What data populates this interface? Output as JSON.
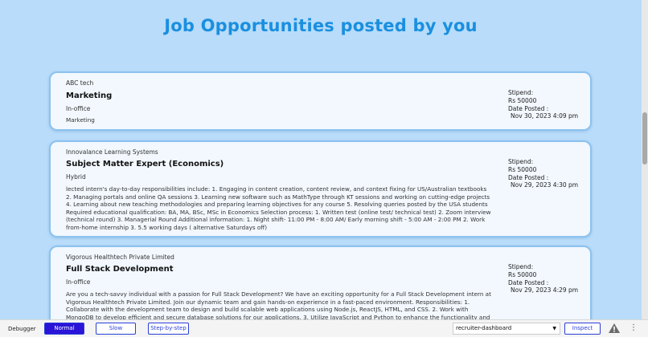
{
  "page": {
    "title": "Job Opportunities posted by you"
  },
  "jobs": [
    {
      "company": "ABC tech",
      "title": "Marketing",
      "mode": "In-office",
      "description": "Marketing",
      "stipend_label": "Stipend:",
      "stipend": "Rs 50000",
      "date_label": "Date Posted :",
      "date": "Nov 30, 2023 4:09 pm"
    },
    {
      "company": "Innovalance Learning Systems",
      "title": "Subject Matter Expert (Economics)",
      "mode": "Hybrid",
      "description": "lected intern's day-to-day responsibilities include:  1. Engaging in content creation, content review, and context fixing for US/Australian textbooks 2. Managing portals and online QA sessions 3. Learning new software such as MathType through KT sessions and working on cutting-edge projects 4. Learning about new teaching methodologies and preparing learning objectives for any course 5. Resolving queries posted by the USA students  Required educational qualification: BA, MA, BSc, MSc in Economics  Selection process:  1. Written test (online test/ technical test) 2. Zoom interview (technical round) 3. Managerial Round  Additional information:  1. Night shift- 11:00 PM - 8:00 AM/ Early morning shift - 5:00 AM - 2:00 PM 2. Work from-home internship 3. 5.5 working days ( alternative Saturdays off)",
      "stipend_label": "Stipend:",
      "stipend": "Rs 50000",
      "date_label": "Date Posted :",
      "date": "Nov 29, 2023 4:30 pm"
    },
    {
      "company": "Vigorous Healthtech Private Limited",
      "title": "Full Stack Development",
      "mode": "In-office",
      "description": "Are you a tech-savvy individual with a passion for Full Stack Development? We have an exciting opportunity for a Full Stack Development intern at Vigorous Healthtech Private Limited. Join our dynamic team and gain hands-on experience in a fast-paced environment.  Responsibilities: 1. Collaborate with the development team to design and build scalable web applications using Node.js, ReactJS, HTML, and CSS. 2. Work with MongoDB to develop efficient and secure database solutions for our applications. 3. Utilize JavaScript and Python to enhance the functionality and performance of our web",
      "stipend_label": "Stipend:",
      "stipend": "Rs 50000",
      "date_label": "Date Posted :",
      "date": "Nov 29, 2023 4:29 pm"
    }
  ],
  "debugger": {
    "label": "Debugger",
    "normal": "Normal",
    "slow": "Slow",
    "step": "Step-by-step",
    "dashboard": "recruiter-dashboard",
    "inspect": "Inspect"
  },
  "colors": {
    "title": "#1a8fdf",
    "background": "#b8dcfa",
    "card_border": "#8cc2ef",
    "debug_active": "#2a14d8"
  }
}
